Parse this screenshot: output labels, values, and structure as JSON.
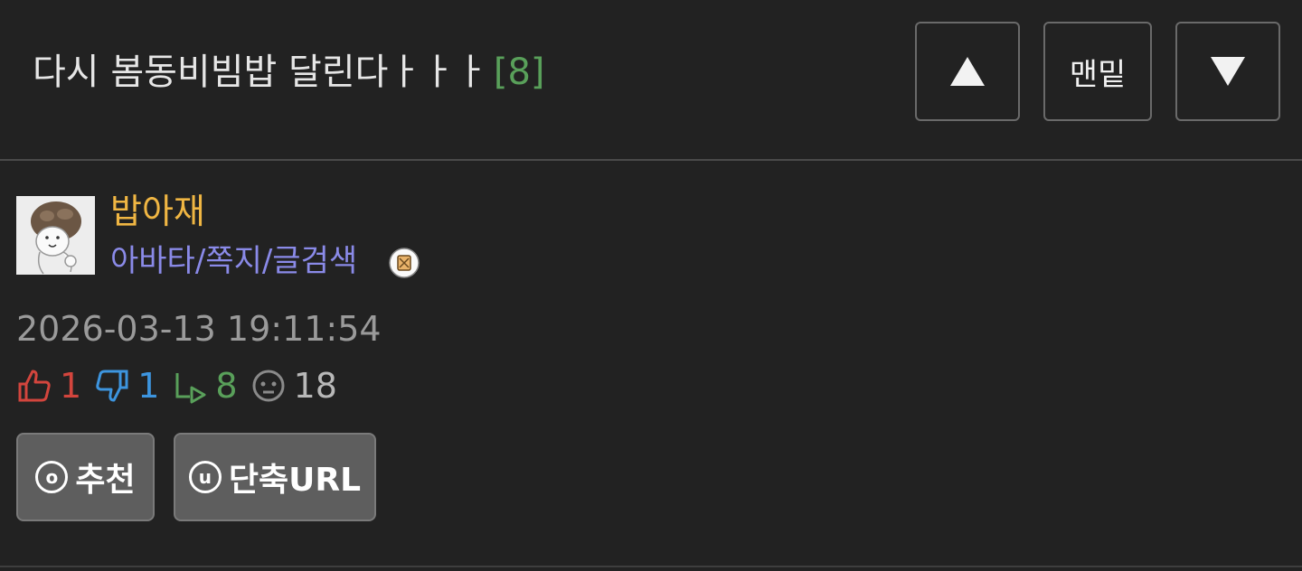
{
  "header": {
    "title": "다시 봄동비빔밥 달린다ㅏㅏㅏ",
    "comment_count": "[8]",
    "nav": {
      "up_icon": "triangle-up-icon",
      "bottom_label": "맨밑",
      "down_icon": "triangle-down-icon"
    }
  },
  "author": {
    "avatar_icon": "avatar-character-icon",
    "name": "밥아재",
    "links": "아바타/쪽지/글검색",
    "badge_icon": "level-badge-icon"
  },
  "post": {
    "datetime": "2026-03-13 19:11:54",
    "stats": {
      "likes": "1",
      "dislikes": "1",
      "replies": "8",
      "views": "18"
    }
  },
  "actions": {
    "recommend_icon_letter": "o",
    "recommend_label": "추천",
    "shorturl_icon_letter": "u",
    "shorturl_label": "단축URL"
  },
  "colors": {
    "background": "#222222",
    "username": "#f0b643",
    "links": "#8a8ae8",
    "comment_count": "#59a05a",
    "like": "#d3453d",
    "dislike": "#3d95df",
    "reply": "#59a05a"
  }
}
